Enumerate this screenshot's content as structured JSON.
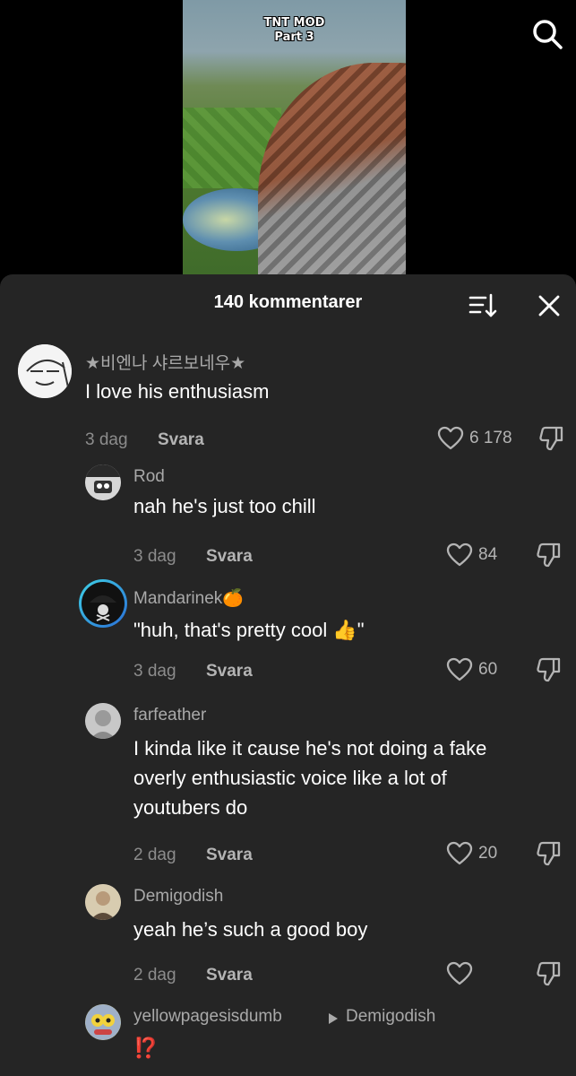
{
  "video": {
    "title_line1": "TNT MOD",
    "title_line2": "Part 3"
  },
  "icons": {
    "search": "search-icon",
    "sort": "sort-icon",
    "close": "close-icon",
    "like": "heart-icon",
    "dislike": "thumbs-down-icon",
    "reply_arrow": "caret-right-icon"
  },
  "sheet": {
    "title": "140 kommentarer"
  },
  "comments": [
    {
      "username": "★비엔나 샤르보네우★",
      "text": "I love his enthusiasm",
      "time": "3 dag",
      "reply": "Svara",
      "likes": "6 178"
    },
    {
      "username": "Rod",
      "text": "nah he's just too chill",
      "time": "3 dag",
      "reply": "Svara",
      "likes": "84"
    },
    {
      "username": "Mandarinek🍊",
      "text": "\"huh, that's pretty cool 👍\"",
      "time": "3 dag",
      "reply": "Svara",
      "likes": "60"
    },
    {
      "username": "farfeather",
      "text_lines": [
        "I kinda like it cause he's not doing a fake",
        "overly enthusiastic voice like a lot of",
        "youtubers do"
      ],
      "time": "2 dag",
      "reply": "Svara",
      "likes": "20"
    },
    {
      "username": "Demigodish",
      "text": "yeah he’s such a good boy",
      "time": "2 dag",
      "reply": "Svara",
      "likes": ""
    },
    {
      "username": "yellowpagesisdumb",
      "reply_to": "Demigodish",
      "text": "⁉️"
    }
  ],
  "colors": {
    "background": "#000000",
    "sheet": "#252525",
    "username": "#a9a9a9",
    "meta": "#8c8c8c"
  }
}
